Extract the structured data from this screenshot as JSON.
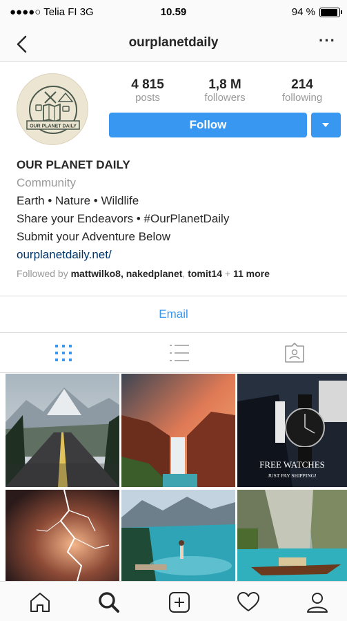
{
  "status_bar": {
    "carrier": "●●●●○ Telia FI  3G",
    "time": "10.59",
    "battery": "94 %"
  },
  "nav": {
    "title": "ourplanetdaily",
    "more": "···"
  },
  "profile": {
    "avatar_logo_text": "OUR PLANET DAILY",
    "stats": [
      {
        "value": "4 815",
        "label": "posts"
      },
      {
        "value": "1,8 M",
        "label": "followers"
      },
      {
        "value": "214",
        "label": "following"
      }
    ],
    "follow_label": "Follow",
    "accent_color": "#3897f0"
  },
  "bio": {
    "name": "OUR PLANET DAILY",
    "category": "Community",
    "line1": "Earth • Nature • Wildlife",
    "line2": "Share your Endeavors • #OurPlanetDaily",
    "line3": "Submit your Adventure Below",
    "link": "ourplanetdaily.net/",
    "followed_prefix": "Followed by ",
    "followed_names": "mattwilko8, nakedplanet",
    "followed_sep": ", ",
    "followed_last": "tomit14",
    "followed_plus": " + ",
    "followed_more": "11 more"
  },
  "email_label": "Email",
  "tabs": [
    "grid-icon",
    "list-icon",
    "tagged-icon"
  ],
  "posts": [
    {
      "name": "mountain-road"
    },
    {
      "name": "waterfall-canyon"
    },
    {
      "name": "watch-ad",
      "caption": "FREE WATCHES",
      "subcaption": "JUST PAY SHIPPING!"
    },
    {
      "name": "lightning-storm"
    },
    {
      "name": "turquoise-lake"
    },
    {
      "name": "boat-lagoon"
    }
  ],
  "bottom_nav": [
    "home-icon",
    "search-icon",
    "add-post-icon",
    "activity-heart-icon",
    "profile-icon"
  ]
}
